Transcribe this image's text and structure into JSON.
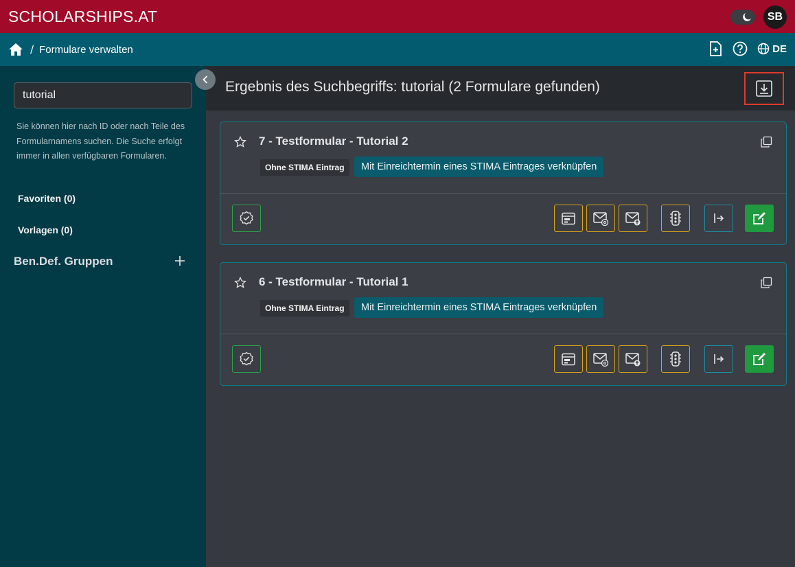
{
  "topbar": {
    "brand": "SCHOLARSHIPS.AT",
    "avatar_initials": "SB"
  },
  "navbar": {
    "breadcrumb_separator": "/",
    "breadcrumb_current": "Formulare verwalten",
    "language": "DE"
  },
  "sidebar": {
    "search_value": "tutorial",
    "hint": "Sie können hier nach ID oder nach Teile des Formularnamens suchen. Die Suche erfolgt immer in allen verfügbaren Formularen.",
    "favorites_label": "Favoriten (0)",
    "templates_label": "Vorlagen (0)",
    "groups_heading": "Ben.Def. Gruppen"
  },
  "main": {
    "result_title": "Ergebnis des Suchbegriffs: tutorial (2 Formulare gefunden)"
  },
  "forms": [
    {
      "title": "7 - Testformular - Tutorial 2",
      "tag_status": "Ohne STIMA Eintrag",
      "tag_link": "Mit Einreichtermin eines STIMA Eintrages verknüpfen"
    },
    {
      "title": "6 - Testformular - Tutorial 1",
      "tag_status": "Ohne STIMA Eintrag",
      "tag_link": "Mit Einreichtermin eines STIMA Eintrages verknüpfen"
    }
  ],
  "colors": {
    "topbar": "#a10a28",
    "navbar": "#025b6e",
    "sidebar": "#023a46",
    "accent_yellow": "#d9a21b",
    "accent_green": "#1f9a3f",
    "highlight_red": "#e0392c"
  }
}
